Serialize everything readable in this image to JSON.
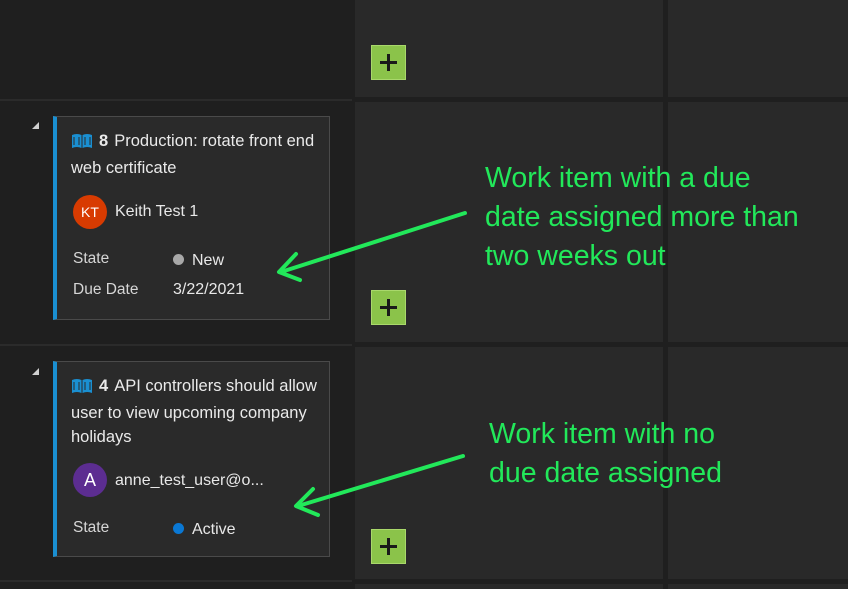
{
  "cards": [
    {
      "id": "8",
      "title": "Production: rotate front end web certificate",
      "avatar_initials": "KT",
      "avatar_color": "#d83b01",
      "assignee": "Keith Test 1",
      "fields": [
        {
          "label": "State",
          "value": "New",
          "dot_color": "#a8a8a8"
        },
        {
          "label": "Due Date",
          "value": "3/22/2021"
        }
      ]
    },
    {
      "id": "4",
      "title": "API controllers should allow user to view upcoming company holidays",
      "avatar_initials": "A",
      "avatar_color": "#5c2d91",
      "assignee": "anne_test_user@o...",
      "fields": [
        {
          "label": "State",
          "value": "Active",
          "dot_color": "#0a78d4"
        }
      ]
    }
  ],
  "annotations": [
    {
      "lines": [
        "Work item with a due",
        "date assigned more than",
        "two weeks out"
      ]
    },
    {
      "lines": [
        "Work item with no",
        "due date assigned"
      ]
    }
  ],
  "colors": {
    "card_accent": "#1a8fd1",
    "add_button": "#8bc34a",
    "annotation": "#22e85a"
  },
  "icons": [
    "book-icon",
    "add-icon",
    "collapse-icon"
  ]
}
